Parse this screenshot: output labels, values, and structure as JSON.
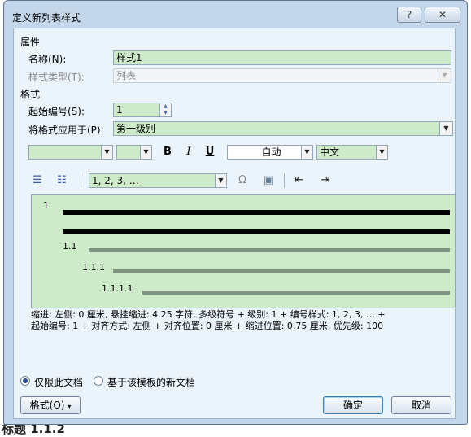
{
  "window": {
    "title": "定义新列表样式",
    "help_label": "?",
    "close_label": "✕"
  },
  "properties": {
    "section_label": "属性",
    "name_label": "名称(N):",
    "name_value": "样式1",
    "type_label": "样式类型(T):",
    "type_value": "列表"
  },
  "format": {
    "section_label": "格式",
    "start_label": "起始编号(S):",
    "start_value": "1",
    "apply_label": "将格式应用于(P):",
    "apply_value": "第一级别",
    "bold_label": "B",
    "italic_label": "I",
    "underline_label": "U",
    "color_value": "自动",
    "script_value": "中文",
    "numbering_style_value": "1, 2, 3, …",
    "symbol_label": "Ω"
  },
  "preview": {
    "levels": [
      "1",
      "1.1",
      "1.1.1",
      "1.1.1.1"
    ]
  },
  "description": {
    "line1": "缩进: 左侧:  0 厘米, 悬挂缩进: 4.25 字符, 多级符号 + 级别: 1 + 编号样式: 1, 2, 3, … +",
    "line2": "起始编号: 1 + 对齐方式: 左侧 + 对齐位置:  0 厘米 + 缩进位置:  0.75 厘米, 优先级: 100"
  },
  "options": {
    "this_doc_label": "仅限此文档",
    "template_label": "基于该模板的新文档",
    "selected": "this_doc"
  },
  "buttons": {
    "format_label": "格式(O)",
    "ok_label": "确定",
    "cancel_label": "取消"
  },
  "background": {
    "partial_text": "标题 1.1.2"
  },
  "colors": {
    "dialog_frame": "#c3d6ea",
    "field_green": "#cdebc9",
    "panel": "#ecf4fb"
  }
}
